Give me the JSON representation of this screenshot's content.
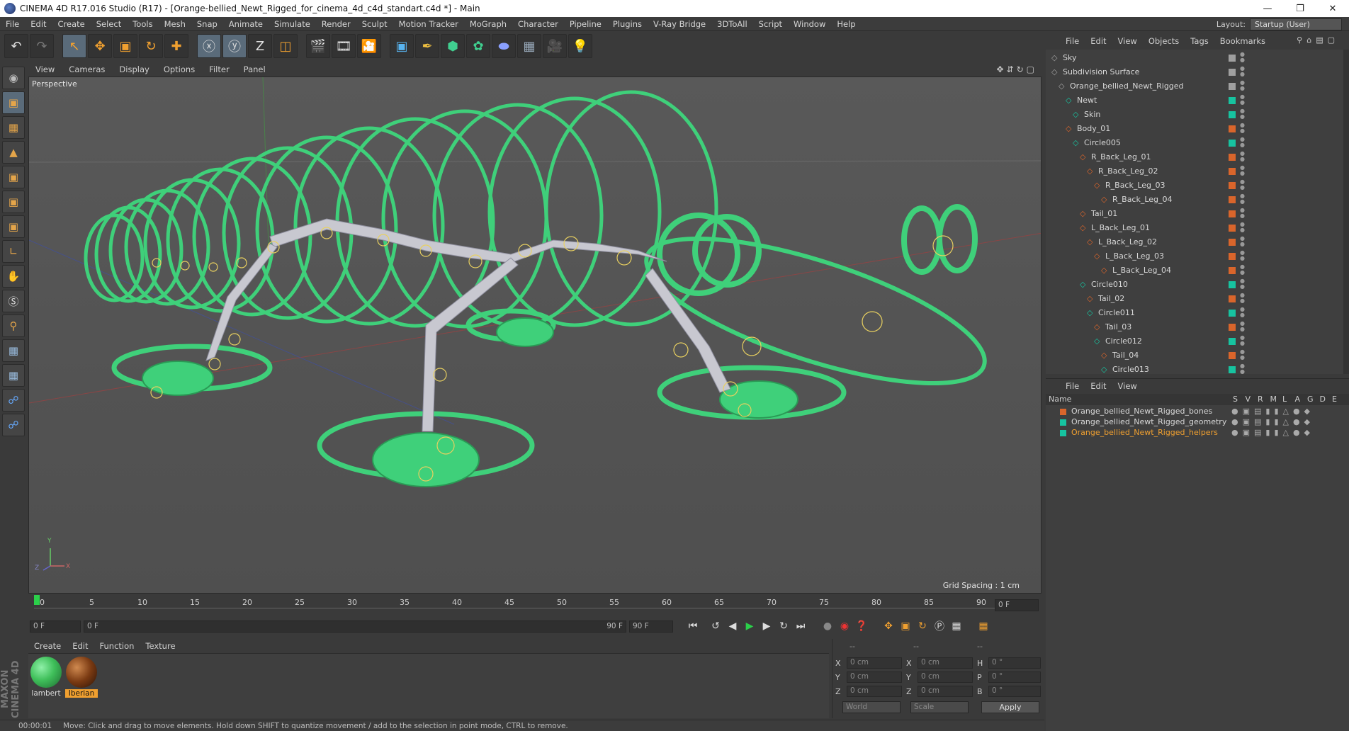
{
  "title": "CINEMA 4D R17.016 Studio (R17) - [Orange-bellied_Newt_Rigged_for_cinema_4d_c4d_standart.c4d *] - Main",
  "menu": [
    "File",
    "Edit",
    "Create",
    "Select",
    "Tools",
    "Mesh",
    "Snap",
    "Animate",
    "Simulate",
    "Render",
    "Sculpt",
    "Motion Tracker",
    "MoGraph",
    "Character",
    "Pipeline",
    "Plugins",
    "V-Ray Bridge",
    "3DToAll",
    "Script",
    "Window",
    "Help"
  ],
  "layout": {
    "label": "Layout:",
    "value": "Startup (User)"
  },
  "viewport": {
    "menu": [
      "View",
      "Cameras",
      "Display",
      "Options",
      "Filter",
      "Panel"
    ],
    "label": "Perspective",
    "grid_spacing": "Grid Spacing : 1 cm",
    "axis": {
      "y": "Y",
      "z": "Z",
      "x": "X"
    }
  },
  "timeline": {
    "ticks": [
      "0",
      "5",
      "10",
      "15",
      "20",
      "25",
      "30",
      "35",
      "40",
      "45",
      "50",
      "55",
      "60",
      "65",
      "70",
      "75",
      "80",
      "85",
      "90"
    ],
    "current_frame": "0 F",
    "start_field": "0 F",
    "range_start": "0 F",
    "range_end": "90 F",
    "end_field": "90 F"
  },
  "materials": {
    "menu": [
      "Create",
      "Edit",
      "Function",
      "Texture"
    ],
    "items": [
      {
        "name": "lambert",
        "color": "#3fbf5a"
      },
      {
        "name": "Iberian",
        "color": "#7a3a12"
      }
    ]
  },
  "coords": {
    "headers": [
      "--",
      "--",
      "--"
    ],
    "rows": [
      {
        "a": "X",
        "av": "0 cm",
        "b": "X",
        "bv": "0 cm",
        "c": "H",
        "cv": "0 °"
      },
      {
        "a": "Y",
        "av": "0 cm",
        "b": "Y",
        "bv": "0 cm",
        "c": "P",
        "cv": "0 °"
      },
      {
        "a": "Z",
        "av": "0 cm",
        "b": "Z",
        "bv": "0 cm",
        "c": "B",
        "cv": "0 °"
      }
    ],
    "space": "World",
    "mode": "Scale",
    "apply": "Apply"
  },
  "status": {
    "time": "00:00:01",
    "message": "Move: Click and drag to move elements. Hold down SHIFT to quantize movement / add to the selection in point mode, CTRL to remove."
  },
  "object_manager": {
    "menu": [
      "File",
      "Edit",
      "View",
      "Objects",
      "Tags",
      "Bookmarks"
    ],
    "objects": [
      {
        "name": "Sky",
        "depth": 0,
        "color": "#a0a0a0"
      },
      {
        "name": "Subdivision Surface",
        "depth": 0,
        "color": "#a0a0a0"
      },
      {
        "name": "Orange_bellied_Newt_Rigged",
        "depth": 1,
        "color": "#a0a0a0"
      },
      {
        "name": "Newt",
        "depth": 2,
        "color": "#17c3a0"
      },
      {
        "name": "Skin",
        "depth": 3,
        "color": "#17c3a0"
      },
      {
        "name": "Body_01",
        "depth": 2,
        "color": "#d9652b"
      },
      {
        "name": "Circle005",
        "depth": 3,
        "color": "#17c3a0"
      },
      {
        "name": "R_Back_Leg_01",
        "depth": 4,
        "color": "#d9652b"
      },
      {
        "name": "R_Back_Leg_02",
        "depth": 5,
        "color": "#d9652b"
      },
      {
        "name": "R_Back_Leg_03",
        "depth": 6,
        "color": "#d9652b"
      },
      {
        "name": "R_Back_Leg_04",
        "depth": 7,
        "color": "#d9652b"
      },
      {
        "name": "Tail_01",
        "depth": 4,
        "color": "#d9652b"
      },
      {
        "name": "L_Back_Leg_01",
        "depth": 4,
        "color": "#d9652b"
      },
      {
        "name": "L_Back_Leg_02",
        "depth": 5,
        "color": "#d9652b"
      },
      {
        "name": "L_Back_Leg_03",
        "depth": 6,
        "color": "#d9652b"
      },
      {
        "name": "L_Back_Leg_04",
        "depth": 7,
        "color": "#d9652b"
      },
      {
        "name": "Circle010",
        "depth": 4,
        "color": "#17c3a0"
      },
      {
        "name": "Tail_02",
        "depth": 5,
        "color": "#d9652b"
      },
      {
        "name": "Circle011",
        "depth": 5,
        "color": "#17c3a0"
      },
      {
        "name": "Tail_03",
        "depth": 6,
        "color": "#d9652b"
      },
      {
        "name": "Circle012",
        "depth": 6,
        "color": "#17c3a0"
      },
      {
        "name": "Tail_04",
        "depth": 7,
        "color": "#d9652b"
      },
      {
        "name": "Circle013",
        "depth": 7,
        "color": "#17c3a0"
      }
    ]
  },
  "layer_manager": {
    "menu": [
      "File",
      "Edit",
      "View"
    ],
    "columns": {
      "name": "Name",
      "flags": [
        "S",
        "V",
        "R",
        "M",
        "L",
        "A",
        "G",
        "D",
        "E"
      ]
    },
    "layers": [
      {
        "name": "Orange_bellied_Newt_Rigged_bones",
        "color": "#d9652b",
        "selected": false
      },
      {
        "name": "Orange_bellied_Newt_Rigged_geometry",
        "color": "#17c3a0",
        "selected": false
      },
      {
        "name": "Orange_bellied_Newt_Rigged_helpers",
        "color": "#17c3a0",
        "selected": true
      }
    ]
  },
  "colors": {
    "accent": "#f0a030",
    "curve_green": "#3fd07a",
    "bone": "#c8c8d0"
  }
}
